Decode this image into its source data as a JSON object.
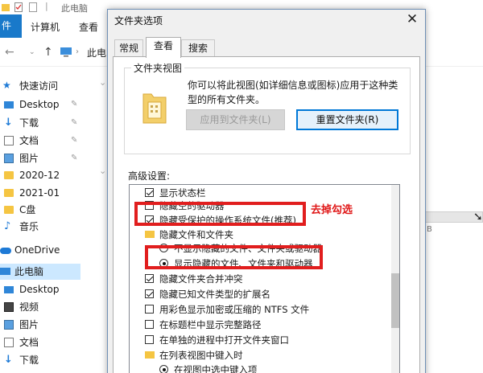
{
  "explorer": {
    "window_title": "此电脑",
    "ribbon": {
      "file_tab": "件",
      "computer_tab": "计算机",
      "view_tab": "查看"
    },
    "address": "此电",
    "sidebar": {
      "items": [
        {
          "label": "快速访问",
          "icon": "star-icon"
        },
        {
          "label": "Desktop",
          "icon": "desktop-icon",
          "pinned": true
        },
        {
          "label": "下载",
          "icon": "download-icon",
          "pinned": true
        },
        {
          "label": "文档",
          "icon": "document-icon",
          "pinned": true
        },
        {
          "label": "图片",
          "icon": "picture-icon",
          "pinned": true
        },
        {
          "label": "2020-12",
          "icon": "folder-icon"
        },
        {
          "label": "2021-01",
          "icon": "folder-icon"
        },
        {
          "label": "C盘",
          "icon": "folder-icon"
        },
        {
          "label": "音乐",
          "icon": "music-icon"
        },
        {
          "label": "OneDrive",
          "icon": "cloud-icon"
        },
        {
          "label": "此电脑",
          "icon": "pc-icon",
          "selected": true
        },
        {
          "label": "Desktop",
          "icon": "desktop-icon"
        },
        {
          "label": "视频",
          "icon": "video-icon"
        },
        {
          "label": "图片",
          "icon": "picture-icon"
        },
        {
          "label": "文档",
          "icon": "document-icon"
        },
        {
          "label": "下载",
          "icon": "download-icon"
        }
      ]
    },
    "drive_text": "B"
  },
  "dialog": {
    "title": "文件夹选项",
    "close_symbol": "✕",
    "tabs": [
      {
        "label": "常规",
        "active": false
      },
      {
        "label": "查看",
        "active": true
      },
      {
        "label": "搜索",
        "active": false
      }
    ],
    "folder_view": {
      "legend": "文件夹视图",
      "description": "你可以将此视图(如详细信息或图标)应用于这种类型的所有文件夹。",
      "apply_button": "应用到文件夹(L)",
      "reset_button": "重置文件夹(R)"
    },
    "advanced_label": "高级设置:",
    "advanced_items": [
      {
        "kind": "checkbox",
        "checked": true,
        "label": "显示状态栏",
        "indent": 0
      },
      {
        "kind": "checkbox",
        "checked": false,
        "label": "隐藏空的驱动器",
        "indent": 0
      },
      {
        "kind": "checkbox",
        "checked": true,
        "label": "隐藏受保护的操作系统文件(推荐)",
        "indent": 0
      },
      {
        "kind": "folder",
        "label": "隐藏文件和文件夹",
        "indent": 0
      },
      {
        "kind": "radio",
        "checked": false,
        "label": "不显示隐藏的文件、文件夹或驱动器",
        "indent": 1
      },
      {
        "kind": "radio",
        "checked": true,
        "label": "显示隐藏的文件、文件夹和驱动器",
        "indent": 1
      },
      {
        "kind": "checkbox",
        "checked": true,
        "label": "隐藏文件夹合并冲突",
        "indent": 0
      },
      {
        "kind": "checkbox",
        "checked": true,
        "label": "隐藏已知文件类型的扩展名",
        "indent": 0
      },
      {
        "kind": "checkbox",
        "checked": false,
        "label": "用彩色显示加密或压缩的 NTFS 文件",
        "indent": 0
      },
      {
        "kind": "checkbox",
        "checked": false,
        "label": "在标题栏中显示完整路径",
        "indent": 0
      },
      {
        "kind": "checkbox",
        "checked": false,
        "label": "在单独的进程中打开文件夹窗口",
        "indent": 0
      },
      {
        "kind": "folder",
        "label": "在列表视图中键入时",
        "indent": 0
      },
      {
        "kind": "radio",
        "checked": true,
        "label": "在视图中选中键入项",
        "indent": 1
      }
    ]
  },
  "annotation": {
    "text": "去掉勾选",
    "color": "#e11e1e"
  }
}
